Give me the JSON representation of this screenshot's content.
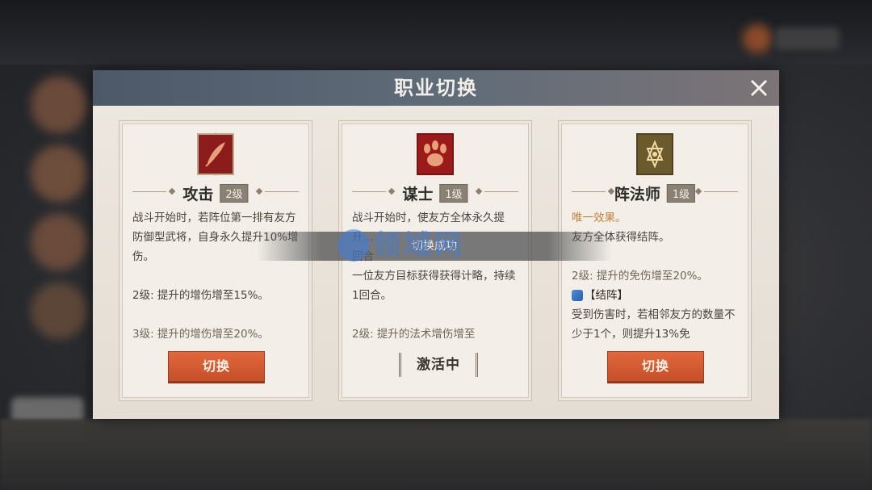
{
  "dialog": {
    "title": "职业切换",
    "close_icon": "close-icon"
  },
  "cards": [
    {
      "emblem_icon": "feather-quill-icon",
      "emblem_color": "#8c1c1c",
      "name": "攻击",
      "level": "2级",
      "description": [
        "战斗开始时，若阵位第一排有友方防御型武将，自身永久提升10%增伤。",
        "2级: 提升的增伤增至15%。",
        "3级: 提升的增伤增至20%。"
      ],
      "button": "切换"
    },
    {
      "emblem_icon": "claw-paw-icon",
      "emblem_color": "#9b1a1a",
      "name": "谋士",
      "level": "1级",
      "description": [
        "战斗开始时，使友方全体永久提升...",
        "回合",
        "一位友方目标获得获得计略，持续1回合。",
        "2级: 提升的法术增伤增至"
      ],
      "status": "激活中"
    },
    {
      "emblem_icon": "hexagram-star-icon",
      "emblem_color": "#6b5a2e",
      "name": "阵法师",
      "level": "1级",
      "description_effect_label": "唯一效果。",
      "description": [
        "友方全体获得结阵。",
        "2级: 提升的免伤增至20%。"
      ],
      "tag_label": "【结阵】",
      "tag_icon": "formation-icon",
      "tag_text": "受到伤害时，若相邻友方的数量不少于1个，则提升13%免",
      "button": "切换"
    }
  ],
  "toast": {
    "text": "切换成功"
  },
  "watermark": {
    "text": "领域网"
  },
  "colors": {
    "header": "#5f6b79",
    "button": "#d65b33",
    "panel": "#e9e3da",
    "accent_text": "#c0803e"
  }
}
